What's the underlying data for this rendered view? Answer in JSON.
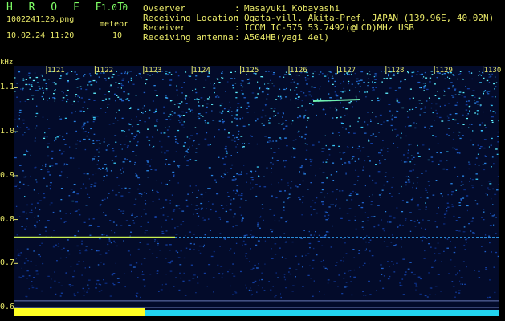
{
  "header": {
    "title": "H R O F F T",
    "version": "1.0.0",
    "filename": "1002241120.png",
    "datetime": "10.02.24 11:20",
    "meteor_label": "meteor",
    "meteor_count": "10"
  },
  "info": [
    {
      "label": "Ovserver",
      "value": "Masayuki Kobayashi"
    },
    {
      "label": "Receiving Location",
      "value": "Ogata-vill. Akita-Pref. JAPAN (139.96E, 40.02N)"
    },
    {
      "label": "Receiver",
      "value": "ICOM IC-575 53.7492(@LCD)MHz USB"
    },
    {
      "label": "Receiving antenna",
      "value": "A504HB(yagi 4el)"
    }
  ],
  "chart_data": {
    "type": "heatmap",
    "ylabel": "kHz",
    "yticks": [
      "1.1",
      "1.0",
      "0.9",
      "0.8",
      "0.7",
      "0.6"
    ],
    "ytick_values": [
      1.1,
      1.0,
      0.9,
      0.8,
      0.7,
      0.6
    ],
    "ylim": [
      0.58,
      1.15
    ],
    "time_labels": [
      "1121",
      "1122",
      "1123",
      "1124",
      "1125",
      "1126",
      "1127",
      "1128",
      "1129",
      "1130"
    ],
    "carrier_khz": 0.76,
    "colors": {
      "low": "#061a5c",
      "mid": "#1f6fd6",
      "high": "#33e6ff",
      "peak": "#ffff33"
    }
  }
}
